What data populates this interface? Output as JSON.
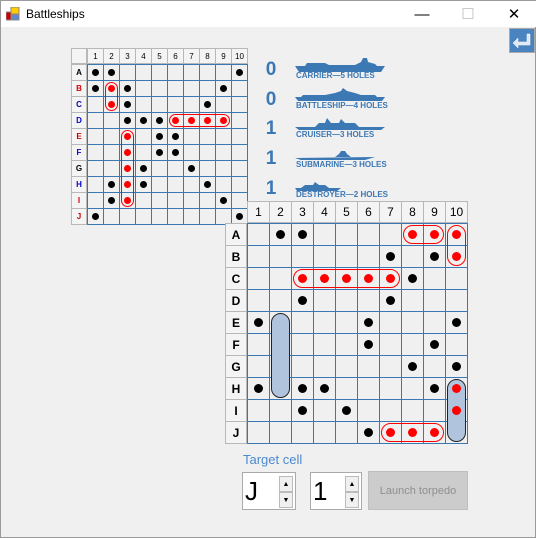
{
  "window": {
    "title": "Battleships",
    "minimize": "—",
    "maximize": "☐",
    "close": "✕"
  },
  "return_button": {
    "icon": "return-arrow-icon"
  },
  "columns": [
    "1",
    "2",
    "3",
    "4",
    "5",
    "6",
    "7",
    "8",
    "9",
    "10"
  ],
  "rows": [
    "A",
    "B",
    "C",
    "D",
    "E",
    "F",
    "G",
    "H",
    "I",
    "J"
  ],
  "colors": {
    "hit": "#ff0000",
    "miss": "#000000",
    "ship_fill": "#b0c4de",
    "grid_line": "#3a78b4",
    "accent": "#3c78b4"
  },
  "small_grid": {
    "row_label_colors": [
      "#000000",
      "#cc0000",
      "#0000aa",
      "#0000cc",
      "#cc0000",
      "#0000cc",
      "#000000",
      "#0000cc",
      "#cc0000",
      "#cc0000"
    ],
    "misses": [
      "A1",
      "A2",
      "A10",
      "B1",
      "B3",
      "B9",
      "C3",
      "C8",
      "D3",
      "D4",
      "D5",
      "E5",
      "E6",
      "F5",
      "F6",
      "G4",
      "G7",
      "H2",
      "H4",
      "H8",
      "I2",
      "I9",
      "J1",
      "J10"
    ],
    "hits": [
      "B2",
      "C2",
      "D6",
      "D7",
      "D8",
      "D9",
      "E3",
      "F3",
      "G3",
      "H3",
      "I3"
    ],
    "sunk_outlines": [
      [
        "B2",
        "C2"
      ],
      [
        "D6",
        "D9"
      ],
      [
        "E3",
        "I3"
      ]
    ]
  },
  "main_grid": {
    "misses": [
      "A2",
      "A3",
      "B7",
      "B9",
      "C8",
      "D3",
      "D7",
      "E1",
      "E6",
      "E10",
      "F6",
      "F9",
      "G8",
      "G10",
      "H1",
      "H3",
      "H4",
      "H9",
      "I3",
      "I5",
      "J6"
    ],
    "hits": [
      "A8",
      "A9",
      "A10",
      "B10",
      "C3",
      "C4",
      "C5",
      "C6",
      "C7",
      "H10",
      "I10",
      "J7",
      "J8",
      "J9"
    ],
    "own_ships": [
      [
        "E2",
        "H2"
      ],
      [
        "H10",
        "J10"
      ]
    ],
    "sunk_outlines": [
      [
        "A8",
        "A9"
      ],
      [
        "A10",
        "B10"
      ],
      [
        "C3",
        "C7"
      ],
      [
        "J7",
        "J9"
      ]
    ]
  },
  "ships": [
    {
      "remaining": "0",
      "label": "CARRIER—5 HOLES"
    },
    {
      "remaining": "0",
      "label": "BATTLESHIP—4 HOLES"
    },
    {
      "remaining": "1",
      "label": "CRUISER—3 HOLES"
    },
    {
      "remaining": "1",
      "label": "SUBMARINE—3 HOLES"
    },
    {
      "remaining": "1",
      "label": "DESTROYER—2 HOLES"
    }
  ],
  "target": {
    "label": "Target cell",
    "row": "J",
    "column": "1",
    "up": "▲",
    "down": "▼",
    "launch_label": "Launch torpedo"
  }
}
